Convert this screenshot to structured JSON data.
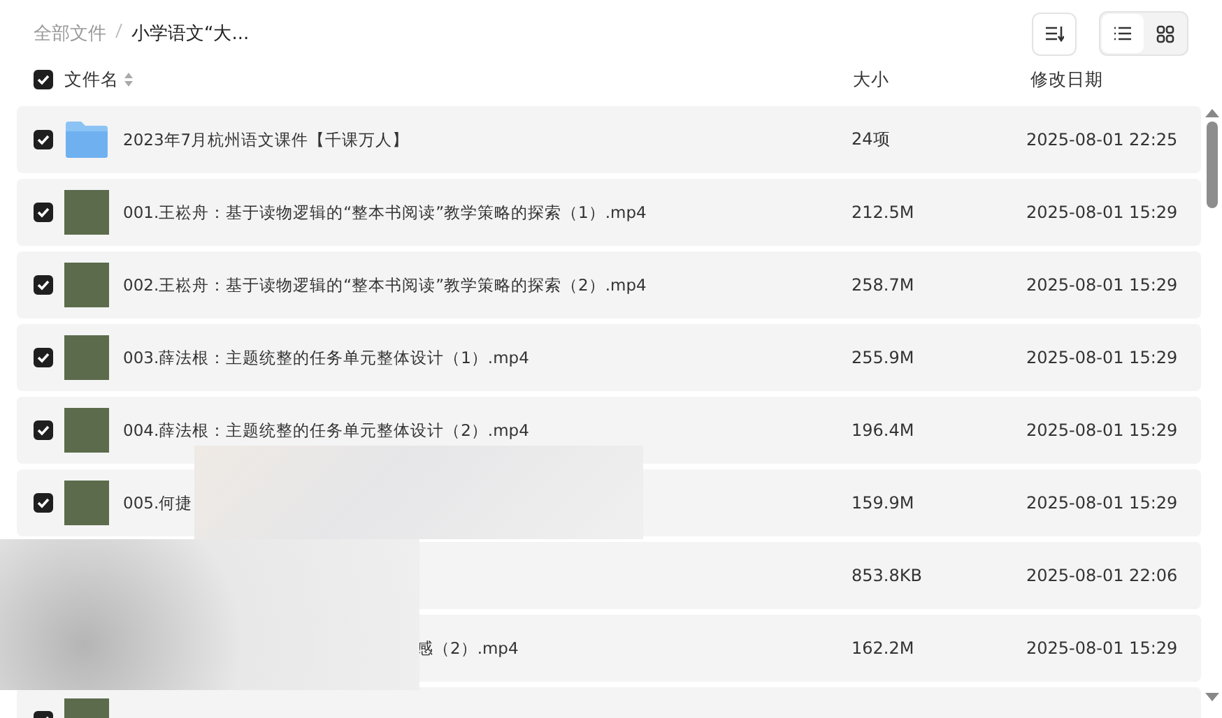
{
  "breadcrumb": [
    {
      "label": "全部文件",
      "current": false
    },
    {
      "label": "小学语文“大...",
      "current": true
    }
  ],
  "toolbar": {
    "view_modes": [
      {
        "kind": "list",
        "selected": true
      },
      {
        "kind": "grid",
        "selected": false
      }
    ]
  },
  "table": {
    "all_checked": true,
    "columns": [
      "文件名",
      "大小",
      "修改日期"
    ],
    "rows": [
      {
        "kind": "folder",
        "checked": true,
        "obscured": false,
        "name": "2023年7月杭州语文课件【千课万人】",
        "size": "24项",
        "date": "2025-08-01 22:25"
      },
      {
        "kind": "video",
        "checked": true,
        "obscured": false,
        "name": "001.王崧舟：基于读物逻辑的“整本书阅读”教学策略的探索（1）.mp4",
        "size": "212.5M",
        "date": "2025-08-01 15:29"
      },
      {
        "kind": "video",
        "checked": true,
        "obscured": false,
        "name": "002.王崧舟：基于读物逻辑的“整本书阅读”教学策略的探索（2）.mp4",
        "size": "258.7M",
        "date": "2025-08-01 15:29"
      },
      {
        "kind": "video",
        "checked": true,
        "obscured": false,
        "name": "003.薛法根：主题统整的任务单元整体设计（1）.mp4",
        "size": "255.9M",
        "date": "2025-08-01 15:29"
      },
      {
        "kind": "video",
        "checked": true,
        "obscured": false,
        "name": "004.薛法根：主题统整的任务单元整体设计（2）.mp4",
        "size": "196.4M",
        "date": "2025-08-01 15:29"
      },
      {
        "kind": "video",
        "checked": true,
        "obscured": false,
        "name": "005.何捷",
        "size": "159.9M",
        "date": "2025-08-01 15:29"
      },
      {
        "size": "853.8KB",
        "date": "2025-08-01 22:06"
      },
      {
        "obscured": true,
        "name": "感（2）.mp4",
        "size": "162.2M",
        "date": "2025-08-01 15:29"
      },
      {
        "kind": "video",
        "checked": true,
        "obscured": false
      }
    ]
  }
}
